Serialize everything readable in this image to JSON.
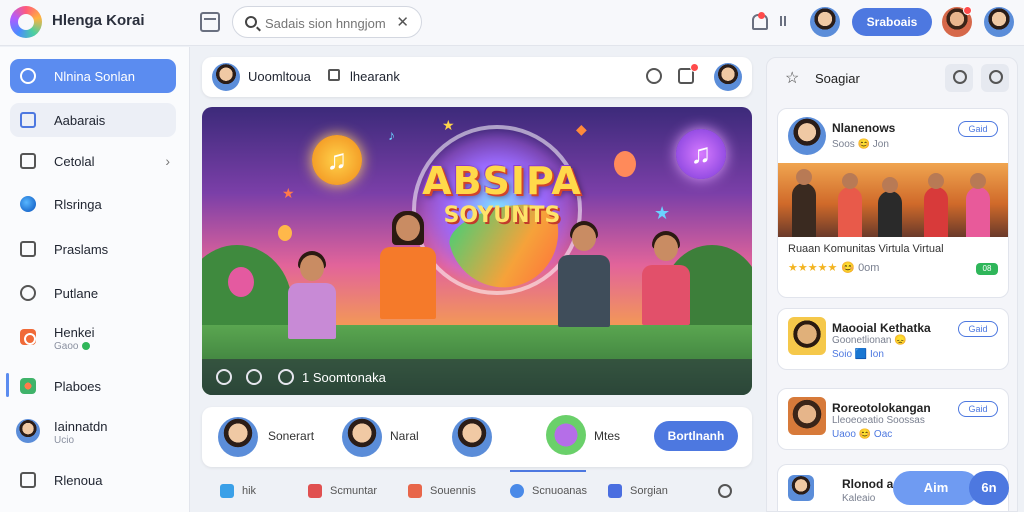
{
  "app": {
    "title": "Hlenga Korai"
  },
  "search": {
    "placeholder": "Sadais sion hnngjom",
    "clear_icon": "close-icon"
  },
  "header": {
    "primary_button": "Sraboais"
  },
  "sidebar": {
    "items": [
      {
        "label": "Nlnina Sonlan",
        "icon": "search-icon"
      },
      {
        "label": "Aabarais",
        "icon": "calendar-icon"
      },
      {
        "label": "Cetolal",
        "icon": "edit-icon"
      },
      {
        "label": "Rlsringa",
        "icon": "globe-icon"
      },
      {
        "label": "Praslams",
        "icon": "list-icon"
      },
      {
        "label": "Putlane",
        "icon": "chat-icon"
      },
      {
        "label": "Henkei",
        "sub": "Gaoo",
        "icon": "record-icon"
      },
      {
        "label": "Plaboes",
        "icon": "flower-icon"
      },
      {
        "label": "Iainnatdn",
        "sub": "Ucio",
        "icon": "avatar"
      },
      {
        "label": "Rlenoua",
        "icon": "share-icon"
      }
    ]
  },
  "feed": {
    "header_user": "Uoomltoua",
    "header_tag": "lhearank",
    "hero": {
      "headline": "ABSIPA",
      "subline": "SOYUNTS",
      "caption": "1 Soomtonaka"
    },
    "people": [
      {
        "name": "Sonerart"
      },
      {
        "name": "Naral"
      },
      {
        "name": ""
      }
    ],
    "people_extra_label": "Mtes",
    "people_cta": "Bortlnanh",
    "tabs": [
      {
        "label": "hik",
        "color": "#3aa0e8"
      },
      {
        "label": "Scmuntar",
        "color": "#e05050"
      },
      {
        "label": "Souennis",
        "color": "#e8664a"
      },
      {
        "label": "Scnuoanas",
        "color": "#4a8ae8"
      },
      {
        "label": "Sorgian",
        "color": "#4a6ee0"
      }
    ]
  },
  "rightpanel": {
    "title": "Soagiar",
    "cards": [
      {
        "name": "Nlanenows",
        "meta": "Soos 😊 Jon",
        "button": "Gaid",
        "caption": "Ruaan Komunitas Virtula Virtual",
        "rating": "★★★★★",
        "rating_meta": "😊 0om",
        "badge": "08"
      },
      {
        "name": "Maooial Kethatka",
        "meta": "Goonetlionan 😞",
        "meta2": "Soio 🟦 Ion",
        "button": "Gaid"
      },
      {
        "name": "Roreotolokangan",
        "meta": "Lleoeoeatio Soossas",
        "meta2": "Uaoo 😊 Oac",
        "button": "Gaid"
      },
      {
        "name": "Rlonod a",
        "meta": "Kaleaio",
        "chip1": "Aim",
        "chip2": "6n"
      }
    ]
  }
}
